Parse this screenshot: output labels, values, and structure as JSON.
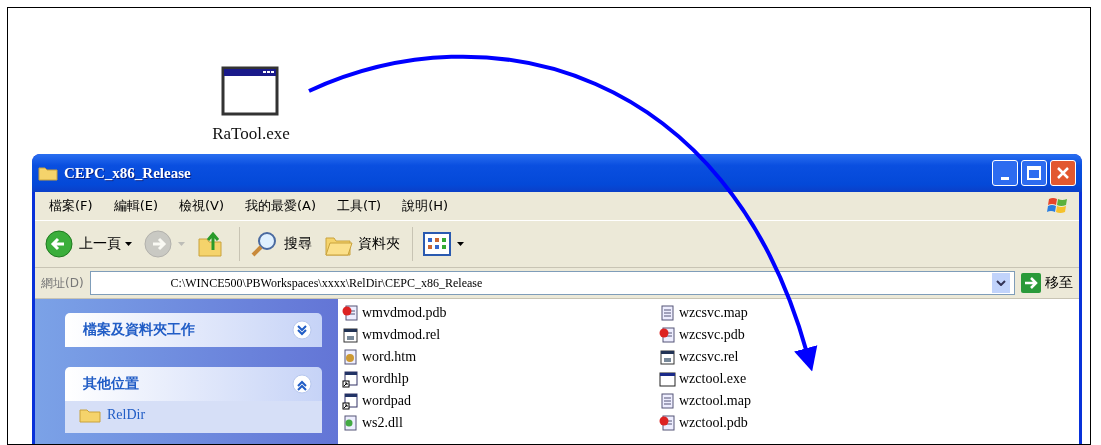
{
  "desktop_icon": {
    "label": "RaTool.exe"
  },
  "window": {
    "title": "CEPC_x86_Release"
  },
  "menu": [
    "檔案(F)",
    "編輯(E)",
    "檢視(V)",
    "我的最愛(A)",
    "工具(T)",
    "說明(H)"
  ],
  "toolbar": [
    {
      "kind": "back",
      "label": "上一頁",
      "dropdown": true,
      "disabled": false
    },
    {
      "kind": "forward",
      "dropdown": true,
      "disabled": true
    },
    {
      "kind": "up",
      "disabled": false
    },
    {
      "kind": "separator"
    },
    {
      "kind": "search",
      "label": "搜尋",
      "disabled": false
    },
    {
      "kind": "folders",
      "label": "資料夾",
      "disabled": false
    },
    {
      "kind": "separator"
    },
    {
      "kind": "views",
      "dropdown": true,
      "disabled": false
    }
  ],
  "address": {
    "label": "網址(D)",
    "value": "C:\\WINCE500\\PBWorkspaces\\xxxx\\RelDir\\CEPC_x86_Release",
    "go": "移至"
  },
  "sidebar": [
    {
      "title": "檔案及資料夾工作",
      "expanded": false
    },
    {
      "title": "其他位置",
      "expanded": true,
      "items": [
        "RelDir"
      ]
    }
  ],
  "files": [
    [
      {
        "name": "wmvdmod.pdb",
        "kind": "pdb"
      },
      {
        "name": "wmvdmod.rel",
        "kind": "rel"
      },
      {
        "name": "word.htm",
        "kind": "htm"
      },
      {
        "name": "wordhlp",
        "kind": "shortcut"
      },
      {
        "name": "wordpad",
        "kind": "shortcut"
      },
      {
        "name": "ws2.dll",
        "kind": "dll"
      }
    ],
    [
      {
        "name": "wzcsvc.map",
        "kind": "map"
      },
      {
        "name": "wzcsvc.pdb",
        "kind": "pdb"
      },
      {
        "name": "wzcsvc.rel",
        "kind": "rel"
      },
      {
        "name": "wzctool.exe",
        "kind": "exe"
      },
      {
        "name": "wzctool.map",
        "kind": "map"
      },
      {
        "name": "wzctool.pdb",
        "kind": "pdb"
      }
    ]
  ]
}
